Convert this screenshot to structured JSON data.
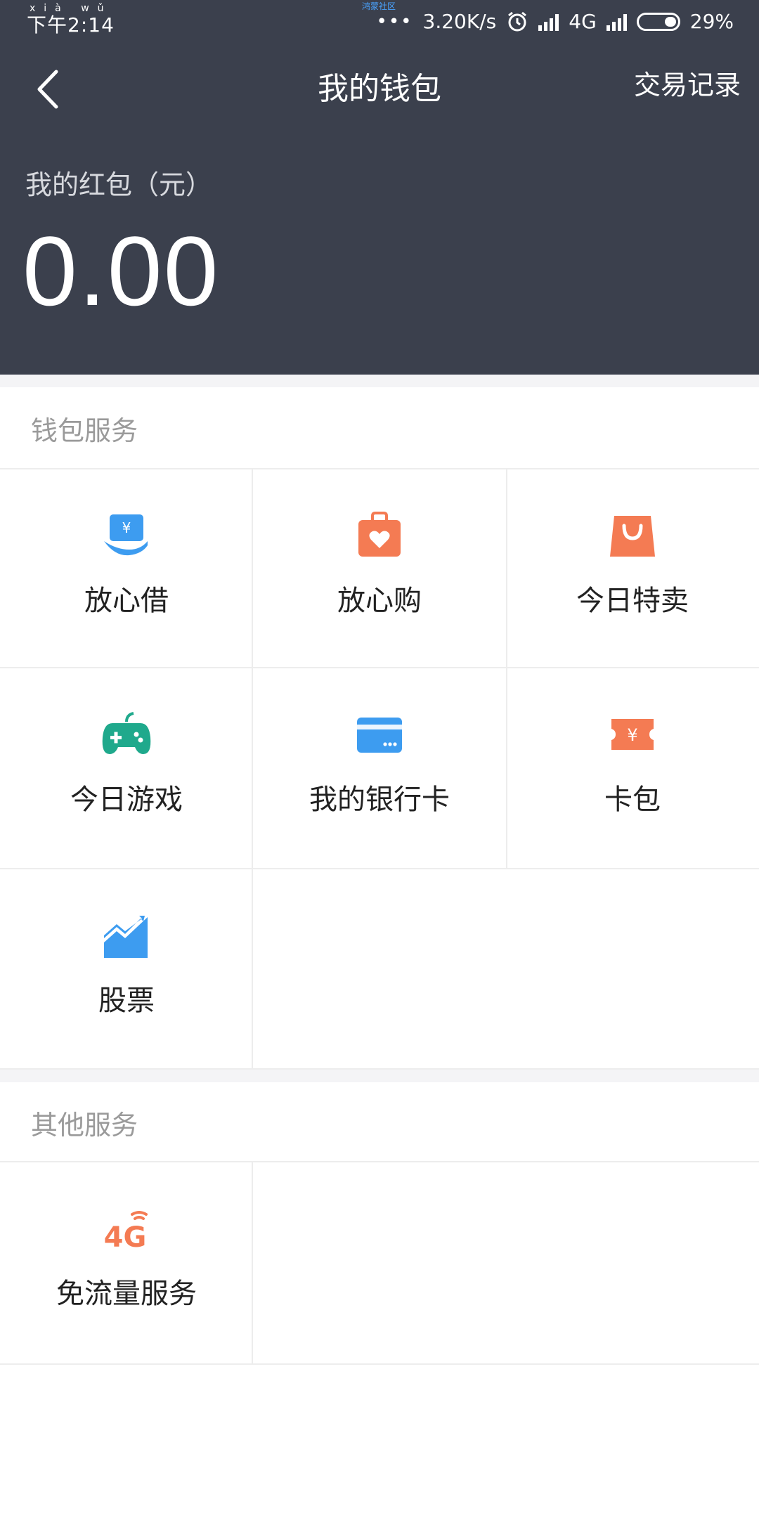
{
  "status_bar": {
    "time": "下午2:14",
    "pinyin": "xià wǔ",
    "center_mini": "鸿蒙社区",
    "network_speed": "3.20K/s",
    "network_type": "4G",
    "battery": "29%"
  },
  "header": {
    "title": "我的钱包",
    "transactions_label": "交易记录",
    "red_packet_label": "我的红包（元）",
    "red_packet_amount": "0.00"
  },
  "wallet_services": {
    "title": "钱包服务",
    "items": [
      {
        "label": "放心借",
        "icon": "loan-icon",
        "color": "#3d9cf0"
      },
      {
        "label": "放心购",
        "icon": "shopping-bag-heart-icon",
        "color": "#f47b53"
      },
      {
        "label": "今日特卖",
        "icon": "shopping-bag-icon",
        "color": "#f47b53"
      },
      {
        "label": "今日游戏",
        "icon": "gamepad-icon",
        "color": "#1fa98c"
      },
      {
        "label": "我的银行卡",
        "icon": "bank-card-icon",
        "color": "#3d9cf0"
      },
      {
        "label": "卡包",
        "icon": "ticket-icon",
        "color": "#f47b53"
      },
      {
        "label": "股票",
        "icon": "stock-chart-icon",
        "color": "#3d9cf0"
      }
    ]
  },
  "other_services": {
    "title": "其他服务",
    "items": [
      {
        "label": "免流量服务",
        "icon": "4g-signal-icon",
        "color": "#f47b53"
      }
    ]
  }
}
